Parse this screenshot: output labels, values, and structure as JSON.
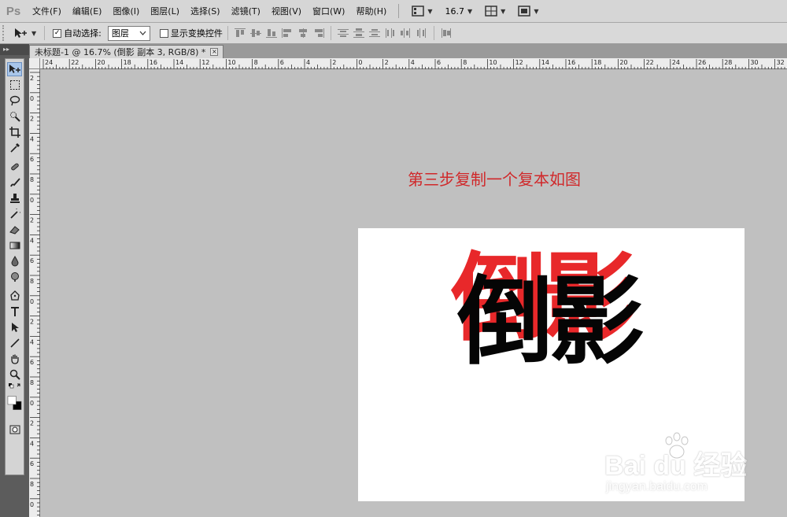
{
  "app": {
    "logo_text": "Ps"
  },
  "menu": [
    "文件(F)",
    "编辑(E)",
    "图像(I)",
    "图层(L)",
    "选择(S)",
    "滤镜(T)",
    "视图(V)",
    "窗口(W)",
    "帮助(H)"
  ],
  "menubar_controls": {
    "zoom_value": "16.7"
  },
  "options": {
    "auto_select_label": "自动选择:",
    "auto_select_checked": "✓",
    "layer_select_value": "图层",
    "show_transform_label": "显示变换控件"
  },
  "document": {
    "tab_title": "未标题-1 @ 16.7% (倒影 副本 3, RGB/8) *",
    "tab_close": "×"
  },
  "ruler": {
    "h_labels": [
      "24",
      "22",
      "20",
      "18",
      "16",
      "14",
      "12",
      "10",
      "8",
      "6",
      "4",
      "2",
      "0",
      "2",
      "4",
      "6",
      "8",
      "10",
      "12",
      "14",
      "16",
      "18",
      "20",
      "22",
      "24",
      "26",
      "28",
      "30",
      "32"
    ],
    "v_labels": [
      "2",
      "0",
      "2",
      "4",
      "6",
      "8",
      "0",
      "2",
      "4",
      "6",
      "8",
      "0",
      "2",
      "4",
      "6",
      "8",
      "0",
      "2",
      "4",
      "6",
      "8",
      "0",
      "2"
    ]
  },
  "canvas": {
    "caption": "第三步复制一个复本如图",
    "red_layer_text": "倒影",
    "black_layer_text": "倒影",
    "red_color": "#e8282a",
    "black_color": "#050505"
  },
  "watermark": {
    "brand": "Bai du 经验",
    "url": "jingyan.baidu.com"
  },
  "colors": {
    "menubar_bg": "#d6d6d6",
    "workspace_bg": "#c0c0c0",
    "toolbox_bg": "#5c5c5c",
    "caption": "#d0282a"
  }
}
